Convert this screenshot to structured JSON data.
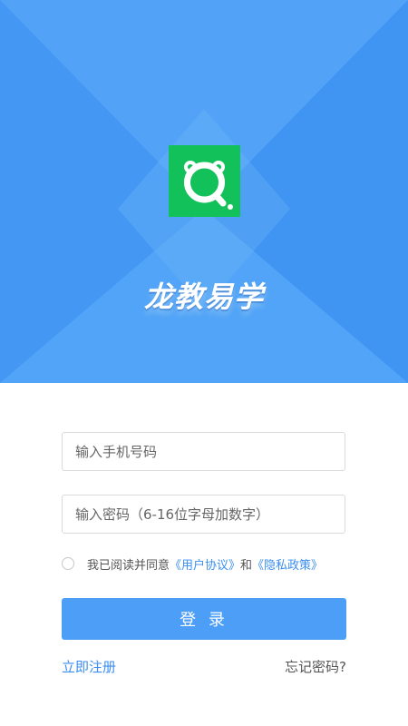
{
  "brand": {
    "name": "龙教易学"
  },
  "login_form": {
    "phone_placeholder": "输入手机号码",
    "password_placeholder": "输入密码（6-16位字母加数字）",
    "agreement": {
      "prefix": "我已阅读并同意",
      "user_agreement": "《用户协议》",
      "conjunction": "和",
      "privacy_policy": "《隐私政策》"
    },
    "login_button": "登 录",
    "register_link": "立即注册",
    "forgot_link": "忘记密码?"
  },
  "colors": {
    "hero_blue": "#4a9df6",
    "logo_green": "#12c159",
    "link_blue": "#3b8ef0",
    "button_blue": "#4d9ef7"
  }
}
